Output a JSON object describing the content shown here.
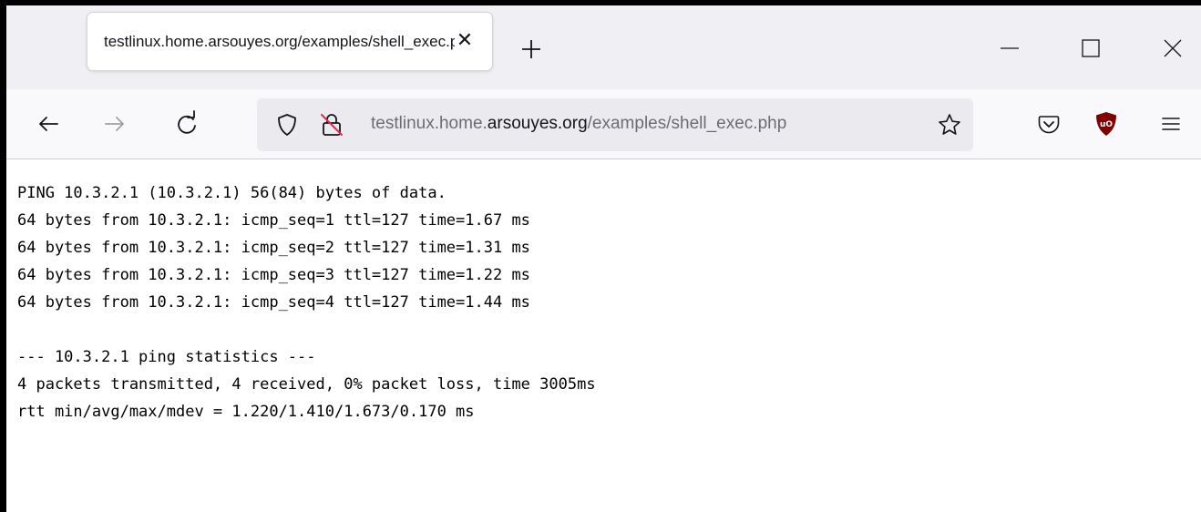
{
  "tab": {
    "title": "testlinux.home.arsouyes.org/examples/shell_exec.php",
    "close_icon": "close-icon"
  },
  "new_tab_icon": "plus-icon",
  "window_controls": [
    "minimize-icon",
    "maximize-icon",
    "close-icon"
  ],
  "navigation": {
    "back_icon": "back-arrow-icon",
    "forward_icon": "forward-arrow-icon",
    "reload_icon": "reload-icon"
  },
  "urlbar": {
    "prefix": "testlinux.home.",
    "domain": "arsouyes.org",
    "path": "/examples/shell_exec.php",
    "shield_icon": "tracking-shield-icon",
    "insecure_icon": "insecure-lock-icon",
    "bookmark_icon": "star-icon"
  },
  "toolbar": {
    "pocket_icon": "pocket-icon",
    "ublock_icon": "ublock-icon",
    "menu_icon": "hamburger-menu-icon"
  },
  "colors": {
    "ublock": "#800000",
    "chrome_bg": "#f0f0f4",
    "urlbar_bg": "#ebebef"
  },
  "output": {
    "lines": [
      "PING 10.3.2.1 (10.3.2.1) 56(84) bytes of data.",
      "64 bytes from 10.3.2.1: icmp_seq=1 ttl=127 time=1.67 ms",
      "64 bytes from 10.3.2.1: icmp_seq=2 ttl=127 time=1.31 ms",
      "64 bytes from 10.3.2.1: icmp_seq=3 ttl=127 time=1.22 ms",
      "64 bytes from 10.3.2.1: icmp_seq=4 ttl=127 time=1.44 ms",
      "",
      "--- 10.3.2.1 ping statistics ---",
      "4 packets transmitted, 4 received, 0% packet loss, time 3005ms",
      "rtt min/avg/max/mdev = 1.220/1.410/1.673/0.170 ms"
    ]
  }
}
